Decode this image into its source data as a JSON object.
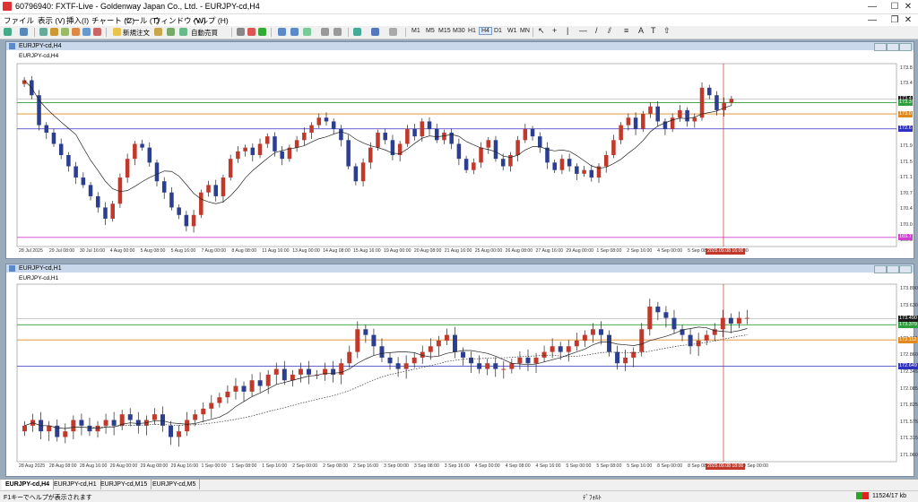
{
  "window": {
    "title": "60796940: FXTF-Live - Goldenway Japan Co., Ltd. - EURJPY-cd,H4"
  },
  "menu": [
    "ファイル",
    "表示 (V)",
    "挿入(I)",
    "チャート (C)",
    "ツール (T)",
    "ウィンドウ (W)",
    "ヘルプ (H)"
  ],
  "toolbar": {
    "new_order": "新規注文",
    "auto_trading": "自動売買",
    "timeframes": [
      "M1",
      "M5",
      "M15",
      "M30",
      "H1",
      "H4",
      "D1",
      "W1",
      "MN"
    ],
    "active_timeframe": "H4"
  },
  "colors": {
    "up": "#c0392b",
    "down": "#2c3e90",
    "current_line": "#c0392b",
    "green_line": "#2e9e3e",
    "orange_line": "#e08a1e",
    "blue_line": "#3030c0",
    "magenta_line": "#d040d0"
  },
  "chart_data": [
    {
      "type": "candlestick",
      "title": "EURJPY-cd,H4",
      "window_title": "EURJPY-cd,H4",
      "ylim": [
        169.6,
        174.2
      ],
      "price_labels": [
        "173.8",
        "173.4",
        "172.9",
        "172.6",
        "172.2",
        "171.9",
        "171.5",
        "171.1",
        "170.7",
        "170.4",
        "170.0",
        "169.6"
      ],
      "badges": [
        {
          "value": "173.4",
          "color": "#1a1a1a"
        },
        {
          "value": "173.3",
          "color": "#2e9e3e"
        },
        {
          "value": "173.0",
          "color": "#e08a1e"
        },
        {
          "value": "172.6",
          "color": "#3030c0"
        },
        {
          "value": "169.7",
          "color": "#d040d0"
        }
      ],
      "lines": {
        "green": 173.3,
        "orange": 173.0,
        "blue": 172.6,
        "magenta": 169.7,
        "current": 173.4
      },
      "date_labels": [
        "28 Jul 2025",
        "29 Jul 08:00",
        "30 Jul 16:00",
        "4 Aug 00:00",
        "5 Aug 08:00",
        "5 Aug 16:00",
        "7 Aug 00:00",
        "8 Aug 08:00",
        "11 Aug 16:00",
        "13 Aug 00:00",
        "14 Aug 08:00",
        "15 Aug 16:00",
        "19 Aug 00:00",
        "20 Aug 08:00",
        "21 Aug 16:00",
        "25 Aug 00:00",
        "26 Aug 08:00",
        "27 Aug 16:00",
        "29 Aug 00:00",
        "1 Sep 08:00",
        "2 Sep 16:00",
        "4 Sep 00:00",
        "5 Sep 08:00"
      ],
      "cursor_label": "2025.09.08 16:00",
      "last_label": "00",
      "closes": [
        173.9,
        173.5,
        172.7,
        172.5,
        172.2,
        171.9,
        171.6,
        171.3,
        171.1,
        170.8,
        170.5,
        170.2,
        170.6,
        171.3,
        171.8,
        172.2,
        172.1,
        171.7,
        171.2,
        170.9,
        170.5,
        170.3,
        170.0,
        170.3,
        170.9,
        171.1,
        170.8,
        171.3,
        171.8,
        172.0,
        172.1,
        171.9,
        172.2,
        172.4,
        172.0,
        171.8,
        172.1,
        172.3,
        172.5,
        172.7,
        172.9,
        172.8,
        172.6,
        172.3,
        171.6,
        171.2,
        171.7,
        172.1,
        172.5,
        172.3,
        171.9,
        172.2,
        172.6,
        172.4,
        172.8,
        172.6,
        172.3,
        172.5,
        172.2,
        171.8,
        171.5,
        171.7,
        172.1,
        172.3,
        171.8,
        171.6,
        171.9,
        172.3,
        172.6,
        172.4,
        172.1,
        171.7,
        171.5,
        171.8,
        171.6,
        171.4,
        171.5,
        171.3,
        171.6,
        171.9,
        172.3,
        172.7,
        172.9,
        172.6,
        173.0,
        173.2,
        172.8,
        172.6,
        172.9,
        173.1,
        172.8,
        172.9,
        173.7,
        173.5,
        173.1,
        173.3,
        173.4
      ]
    },
    {
      "type": "candlestick",
      "title": "EURJPY-cd,H1",
      "window_title": "EURJPY-cd,H1",
      "ylim": [
        171.06,
        174.0
      ],
      "price_labels": [
        "173.890",
        "173.630",
        "173.379",
        "173.112",
        "172.860",
        "172.345",
        "172.085",
        "171.825",
        "171.575",
        "171.315",
        "171.060"
      ],
      "badges": [
        {
          "value": "173.490",
          "color": "#1a1a1a"
        },
        {
          "value": "173.379",
          "color": "#2e9e3e"
        },
        {
          "value": "173.112",
          "color": "#e08a1e"
        },
        {
          "value": "172.649",
          "color": "#3030c0"
        }
      ],
      "lines": {
        "green": 173.379,
        "orange": 173.112,
        "blue": 172.649,
        "current": 173.49
      },
      "date_labels": [
        "28 Aug 2025",
        "28 Aug 08:00",
        "28 Aug 16:00",
        "29 Aug 00:00",
        "29 Aug 08:00",
        "29 Aug 16:00",
        "1 Sep 00:00",
        "1 Sep 08:00",
        "1 Sep 16:00",
        "2 Sep 00:00",
        "2 Sep 08:00",
        "2 Sep 16:00",
        "3 Sep 00:00",
        "3 Sep 08:00",
        "3 Sep 16:00",
        "4 Sep 00:00",
        "4 Sep 08:00",
        "4 Sep 16:00",
        "5 Sep 00:00",
        "5 Sep 08:00",
        "5 Sep 16:00",
        "8 Sep 00:00",
        "8 Sep 08:00"
      ],
      "cursor_label": "2025.09.08 18:00",
      "last_label": "9 Sep 00:00",
      "closes": [
        171.6,
        171.7,
        171.5,
        171.6,
        171.4,
        171.5,
        171.7,
        171.6,
        171.5,
        171.6,
        171.7,
        171.6,
        171.8,
        171.7,
        171.6,
        171.7,
        171.8,
        171.6,
        171.4,
        171.5,
        171.7,
        171.8,
        171.9,
        172.0,
        172.1,
        172.2,
        172.3,
        172.2,
        172.4,
        172.3,
        172.5,
        172.6,
        172.4,
        172.5,
        172.6,
        172.5,
        172.5,
        172.6,
        172.5,
        172.7,
        172.9,
        173.3,
        173.2,
        173.0,
        172.8,
        172.7,
        172.6,
        172.7,
        172.8,
        172.9,
        173.0,
        173.1,
        173.2,
        172.9,
        172.8,
        172.7,
        172.6,
        172.7,
        172.6,
        172.6,
        172.7,
        172.8,
        172.7,
        172.8,
        172.9,
        173.0,
        172.9,
        173.0,
        173.1,
        173.2,
        173.3,
        173.2,
        172.9,
        172.7,
        172.8,
        172.9,
        173.3,
        173.7,
        173.6,
        173.5,
        173.3,
        173.2,
        173.0,
        173.1,
        173.2,
        173.3,
        173.5,
        173.4,
        173.5,
        173.5
      ]
    }
  ],
  "tabs": [
    "EURJPY-cd,H4",
    "EURJPY-cd,H1",
    "EURJPY-cd,M15",
    "EURJPY-cd,M5"
  ],
  "active_tab": "EURJPY-cd,H4",
  "status": {
    "help": "F1キーでヘルプが表示されます",
    "profile": "ﾃﾞﾌｫﾙﾄ",
    "traffic": "11524/17 kb"
  }
}
